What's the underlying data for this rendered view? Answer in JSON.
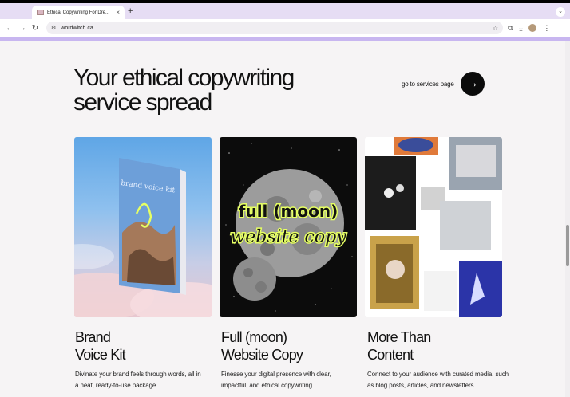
{
  "browser": {
    "tab_title": "Ethical Copywriting For Dre...",
    "tab_close": "×",
    "new_tab": "+",
    "url": "wordwitch.ca",
    "tab_menu": "⌄"
  },
  "page": {
    "heading": "Your ethical copywriting service spread",
    "cta_label": "go to services page",
    "cta_arrow": "→",
    "cards": [
      {
        "title_line1": "Brand",
        "title_line2": "Voice Kit",
        "desc": "Divinate your brand feels through words, all in a neat, ready-to-use package.",
        "book_text": "brand voice kit"
      },
      {
        "title_line1": "Full (moon)",
        "title_line2": "Website Copy",
        "desc": "Finesse your digital presence with clear, impactful, and ethical copywriting.",
        "overlay1": "full (moon)",
        "overlay2": "website copy"
      },
      {
        "title_line1": "More Than",
        "title_line2": "Content",
        "desc": "Connect to your audience with curated media, such as blog posts, articles, and newsletters."
      }
    ]
  },
  "colors": {
    "accent_purple": "#c8b6f0",
    "tab_bar": "#e6ddf4",
    "text": "#111111",
    "moon_text": "#e6ff63"
  }
}
